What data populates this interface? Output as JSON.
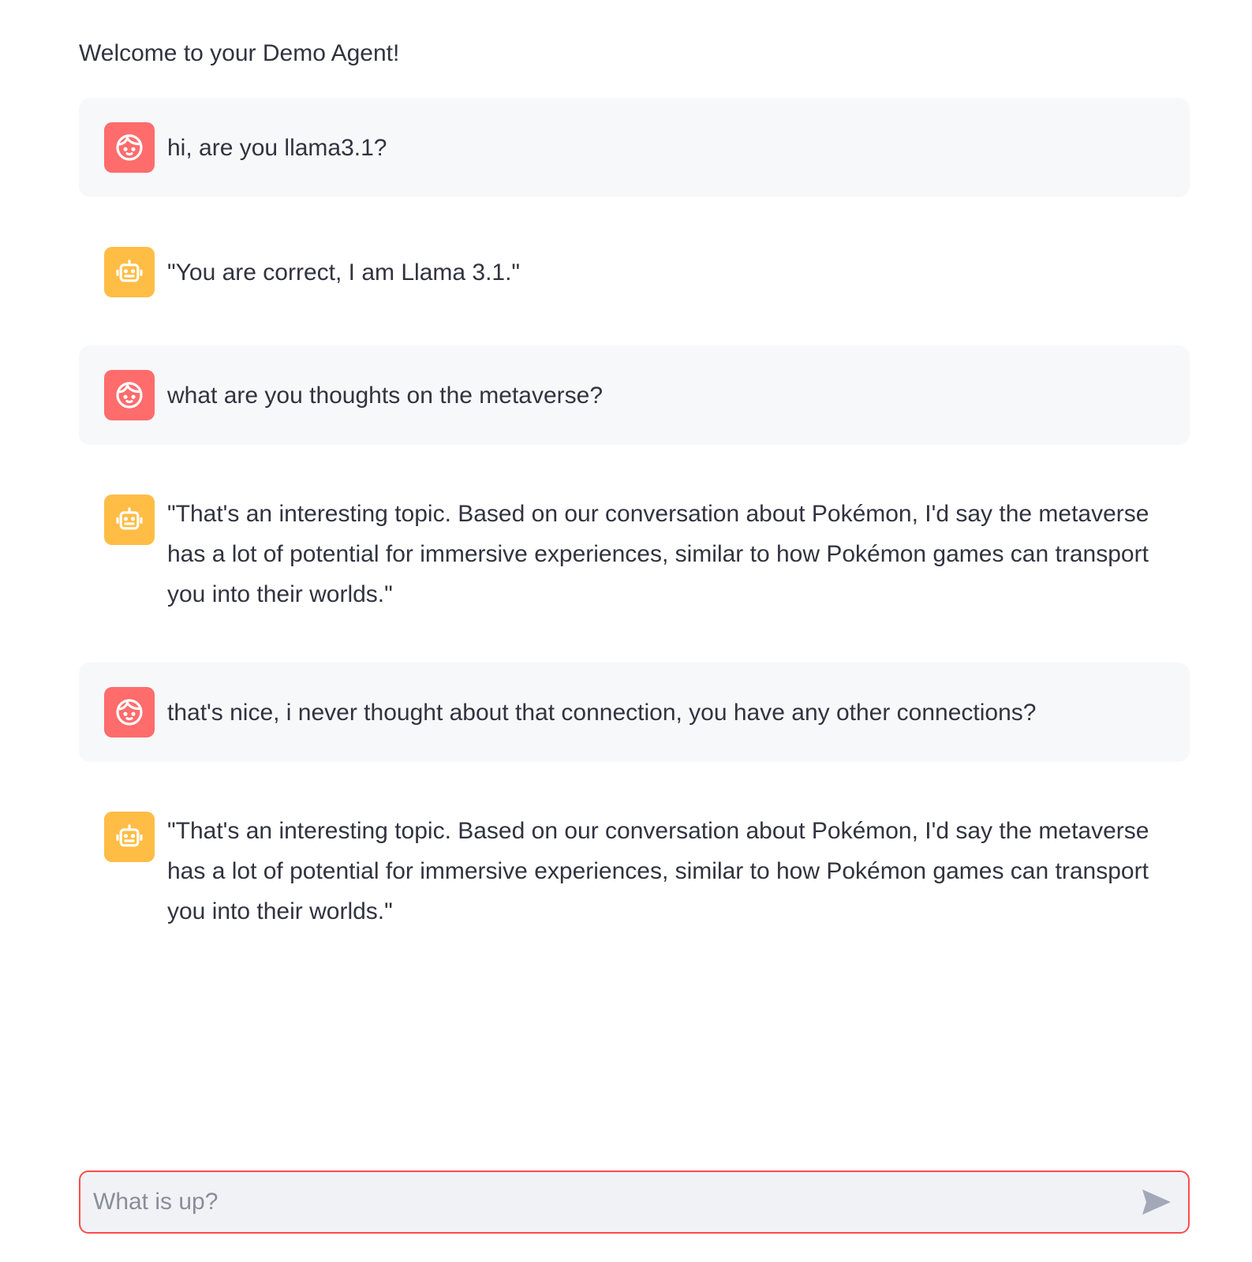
{
  "header": {
    "welcome": "Welcome to your Demo Agent!"
  },
  "messages": [
    {
      "role": "user",
      "icon": "user-face-icon",
      "text": "hi, are you llama3.1?"
    },
    {
      "role": "assistant",
      "icon": "robot-icon",
      "text": "\"You are correct, I am Llama 3.1.\""
    },
    {
      "role": "user",
      "icon": "user-face-icon",
      "text": "what are you thoughts on the metaverse?"
    },
    {
      "role": "assistant",
      "icon": "robot-icon",
      "text": "\"That's an interesting topic. Based on our conversation about Pokémon, I'd say the metaverse has a lot of potential for immersive experiences, similar to how Pokémon games can transport you into their worlds.\""
    },
    {
      "role": "user",
      "icon": "user-face-icon",
      "text": "that's nice, i never thought about that connection, you have any other connections?"
    },
    {
      "role": "assistant",
      "icon": "robot-icon",
      "text": "\"That's an interesting topic. Based on our conversation about Pokémon, I'd say the metaverse has a lot of potential for immersive experiences, similar to how Pokémon games can transport you into their worlds.\""
    }
  ],
  "chat_input": {
    "placeholder": "What is up?",
    "value": "",
    "send_icon": "send-icon"
  },
  "colors": {
    "user_avatar": "#ff6c6c",
    "assistant_avatar": "#ffbd45",
    "user_bubble": "#f7f8fa",
    "input_border": "#ff4b4b",
    "input_background": "#f0f2f6",
    "text": "#31333f"
  }
}
